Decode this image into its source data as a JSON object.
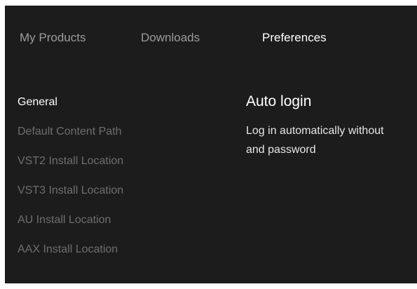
{
  "tabs": [
    {
      "label": "My Products"
    },
    {
      "label": "Downloads"
    },
    {
      "label": "Preferences"
    }
  ],
  "active_tab": "Preferences",
  "sidebar": {
    "items": [
      {
        "label": "General"
      },
      {
        "label": "Default Content Path"
      },
      {
        "label": "VST2 Install Location"
      },
      {
        "label": "VST3 Install Location"
      },
      {
        "label": "AU Install Location"
      },
      {
        "label": "AAX Install Location"
      }
    ],
    "active_item": "General"
  },
  "content": {
    "title": "Auto login",
    "description_line1": "Log in automatically without",
    "description_line2": "and password"
  },
  "colors": {
    "background": "#1c1c1c",
    "active_text": "#ffffff",
    "inactive_tab": "#9c9c9c",
    "inactive_nav": "#6e6e6e"
  }
}
